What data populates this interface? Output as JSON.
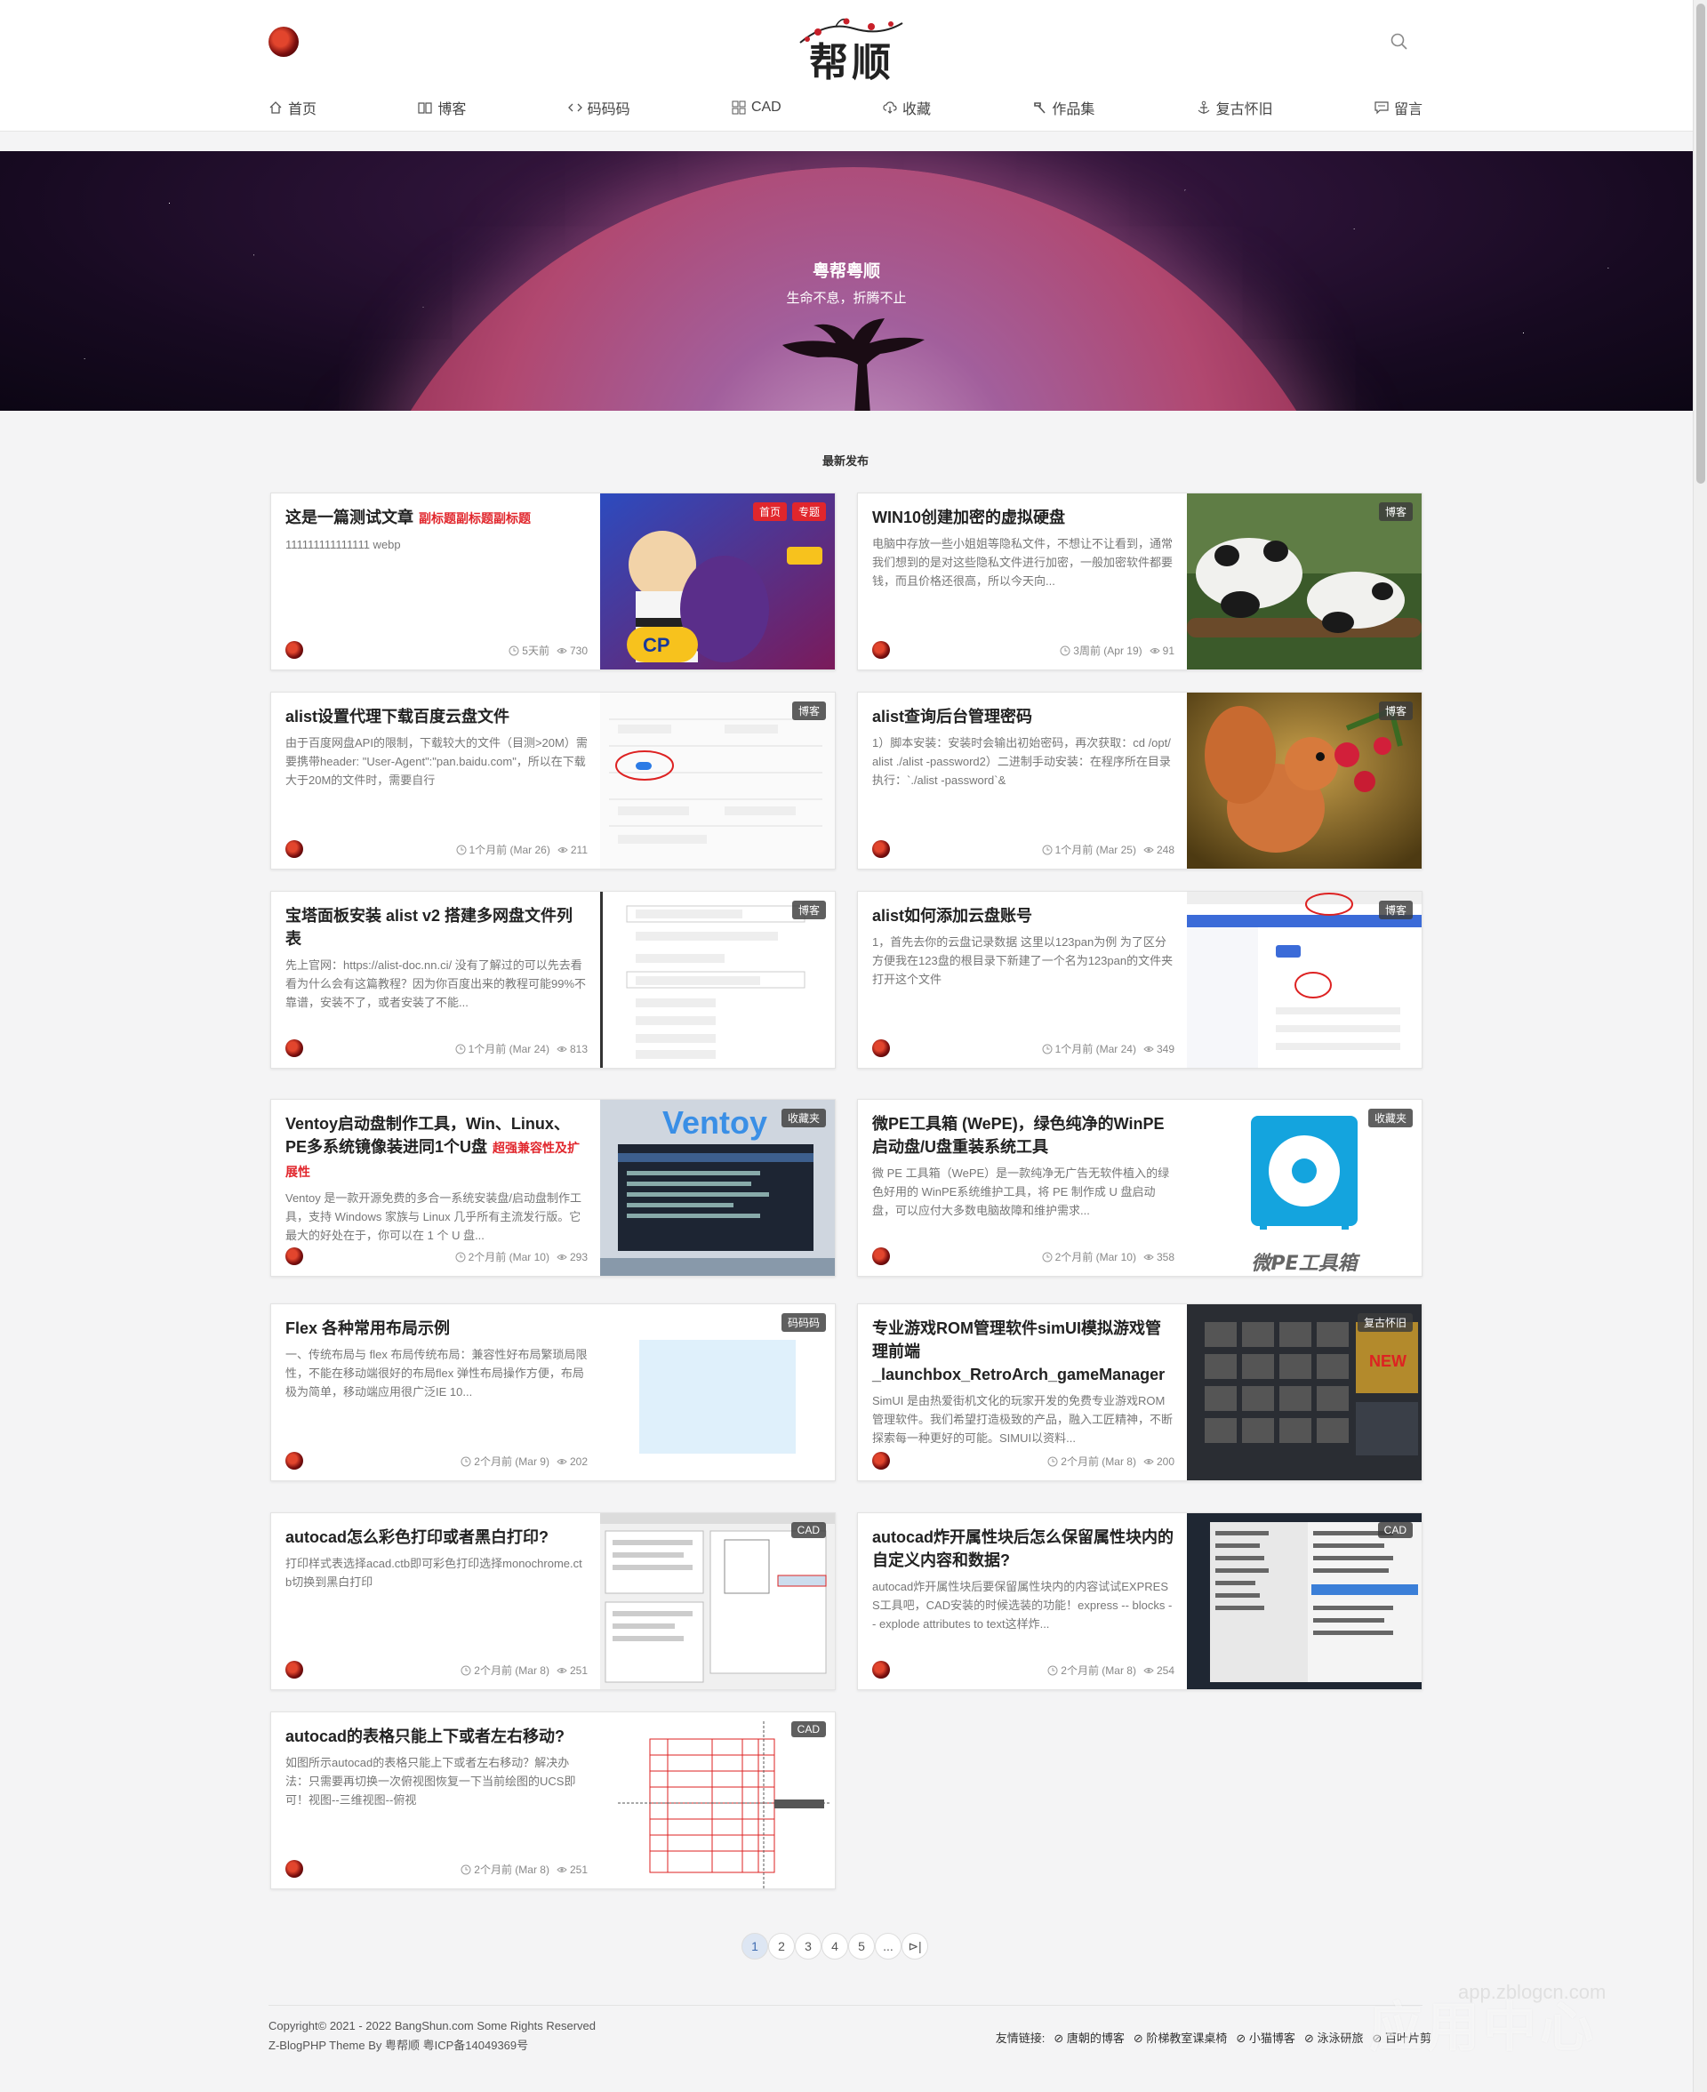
{
  "header": {
    "logo_text": "帮顺",
    "nav": [
      {
        "label": "首页",
        "icon": "home-icon"
      },
      {
        "label": "博客",
        "icon": "book-icon"
      },
      {
        "label": "码码码",
        "icon": "code-icon"
      },
      {
        "label": "CAD",
        "icon": "grid-icon"
      },
      {
        "label": "收藏",
        "icon": "cloud-download-icon"
      },
      {
        "label": "作品集",
        "icon": "hammer-icon"
      },
      {
        "label": "复古怀旧",
        "icon": "anchor-icon"
      },
      {
        "label": "留言",
        "icon": "message-icon"
      }
    ]
  },
  "banner": {
    "title": "粤帮粤顺",
    "subtitle": "生命不息，折腾不止"
  },
  "section_title": "最新发布",
  "posts": [
    {
      "title": "这是一篇测试文章",
      "subtitle": "副标题副标题副标题",
      "excerpt": "111111111111111 webp",
      "time": "5天前",
      "views": "730",
      "tags": [
        {
          "label": "首页",
          "style": "red"
        },
        {
          "label": "专题",
          "style": "red"
        }
      ],
      "thumb": "game-art"
    },
    {
      "title": "WIN10创建加密的虚拟硬盘",
      "subtitle": "",
      "excerpt": "电脑中存放一些小姐姐等隐私文件，不想让不让看到，通常我们想到的是对这些隐私文件进行加密，一般加密软件都要钱，而且价格还很高，所以今天向...",
      "time": "3周前 (Apr 19)",
      "views": "91",
      "tags": [
        {
          "label": "博客",
          "style": "dark"
        }
      ],
      "thumb": "panda"
    },
    {
      "title": "alist设置代理下载百度云盘文件",
      "subtitle": "",
      "excerpt": "由于百度网盘API的限制，下载较大的文件（目测>20M）需要携带header: \"User-Agent\":\"pan.baidu.com\"，所以在下载大于20M的文件时，需要自行",
      "time": "1个月前 (Mar 26)",
      "views": "211",
      "tags": [
        {
          "label": "博客",
          "style": "dark"
        }
      ],
      "thumb": "form-screenshot"
    },
    {
      "title": "alist查询后台管理密码",
      "subtitle": "",
      "excerpt": "1）脚本安装：安装时会输出初始密码，再次获取：cd /opt/alist ./alist -password2）二进制手动安装：在程序所在目录执行：`./alist -password`&",
      "time": "1个月前 (Mar 25)",
      "views": "248",
      "tags": [
        {
          "label": "博客",
          "style": "dark"
        }
      ],
      "thumb": "squirrel"
    },
    {
      "title": "宝塔面板安装 alist v2 搭建多网盘文件列表",
      "subtitle": "",
      "excerpt": "先上官网：https://alist-doc.nn.ci/ 没有了解过的可以先去看看为什么会有这篇教程？因为你百度出来的教程可能99%不靠谱，安装不了，或者安装了不能...",
      "time": "1个月前 (Mar 24)",
      "views": "813",
      "tags": [
        {
          "label": "博客",
          "style": "dark"
        }
      ],
      "thumb": "panel-screenshot"
    },
    {
      "title": "alist如何添加云盘账号",
      "subtitle": "",
      "excerpt": "1，首先去你的云盘记录数据 这里以123pan为例 为了区分方便我在123盘的根目录下新建了一个名为123pan的文件夹 打开这个文件",
      "time": "1个月前 (Mar 24)",
      "views": "349",
      "tags": [
        {
          "label": "博客",
          "style": "dark"
        }
      ],
      "thumb": "cloud-screenshot"
    },
    {
      "title": "Ventoy启动盘制作工具，Win、Linux、PE多系统镜像装进同1个U盘",
      "subtitle": "超强兼容性及扩展性",
      "excerpt": "Ventoy 是一款开源免费的多合一系统安装盘/启动盘制作工具，支持 Windows 家族与 Linux 几乎所有主流发行版。它最大的好处在于，你可以在 1 个 U 盘...",
      "time": "2个月前 (Mar 10)",
      "views": "293",
      "tags": [
        {
          "label": "收藏夹",
          "style": "dark"
        }
      ],
      "thumb": "ventoy"
    },
    {
      "title": "微PE工具箱 (WePE)，绿色纯净的WinPE启动盘/U盘重装系统工具",
      "subtitle": "",
      "excerpt": "微 PE 工具箱（WePE）是一款纯净无广告无软件植入的绿色好用的 WinPE系统维护工具，将 PE 制作成 U 盘启动盘，可以应付大多数电脑故障和维护需求...",
      "time": "2个月前 (Mar 10)",
      "views": "358",
      "tags": [
        {
          "label": "收藏夹",
          "style": "dark"
        }
      ],
      "thumb": "wepe",
      "thumb_caption": "微PE工具箱"
    },
    {
      "title": "Flex 各种常用布局示例",
      "subtitle": "",
      "excerpt": "一、传统布局与 flex 布局传统布局：兼容性好布局繁琐局限性，不能在移动端很好的布局flex 弹性布局操作方便，布局极为简单，移动端应用很广泛IE 10...",
      "time": "2个月前 (Mar 9)",
      "views": "202",
      "tags": [
        {
          "label": "码码码",
          "style": "dark"
        }
      ],
      "thumb": "flex-box"
    },
    {
      "title": "专业游戏ROM管理软件simUI模拟游戏管理前端_launchbox_RetroArch_gameManager",
      "subtitle": "",
      "excerpt": "SimUI 是由热爱街机文化的玩家开发的免费专业游戏ROM管理软件。我们希望打造极致的产品，融入工匠精神，不断探索每一种更好的可能。SIMUI以资料...",
      "time": "2个月前 (Mar 8)",
      "views": "200",
      "tags": [
        {
          "label": "复古怀旧",
          "style": "dark"
        }
      ],
      "thumb": "simui"
    },
    {
      "title": "autocad怎么彩色打印或者黑白打印?",
      "subtitle": "",
      "excerpt": "打印样式表选择acad.ctb即可彩色打印选择monochrome.ctb切换到黑白打印",
      "time": "2个月前 (Mar 8)",
      "views": "251",
      "tags": [
        {
          "label": "CAD",
          "style": "dark"
        }
      ],
      "thumb": "cad-print"
    },
    {
      "title": "autocad炸开属性块后怎么保留属性块内的自定义内容和数据?",
      "subtitle": "",
      "excerpt": "autocad炸开属性块后要保留属性块内的内容试试EXPRESS工具吧，CAD安装的时候选装的功能！express -- blocks -- explode attributes to text这样炸...",
      "time": "2个月前 (Mar 8)",
      "views": "254",
      "tags": [
        {
          "label": "CAD",
          "style": "dark"
        }
      ],
      "thumb": "cad-menu"
    },
    {
      "title": "autocad的表格只能上下或者左右移动?",
      "subtitle": "",
      "excerpt": "如图所示autocad的表格只能上下或者左右移动？解决办法：只需要再切换一次俯视图恢复一下当前绘图的UCS即可！视图--三维视图--俯视",
      "time": "2个月前 (Mar 8)",
      "views": "251",
      "tags": [
        {
          "label": "CAD",
          "style": "dark"
        }
      ],
      "thumb": "cad-table"
    }
  ],
  "pagination": {
    "pages": [
      "1",
      "2",
      "3",
      "4",
      "5",
      "...",
      "⊳|"
    ],
    "current": "1"
  },
  "footer": {
    "copyright_line1": "Copyright© 2021 - 2022 BangShun.com Some Rights Reserved",
    "copyright_line2": "Z-BlogPHP Theme By 粤帮顺  粤ICP备14049369号",
    "friend_label": "友情链接:",
    "friend_links": [
      "唐朝的博客",
      "阶梯教室课桌椅",
      "小猫博客",
      "泳泳研旅",
      "百叶片剪"
    ]
  },
  "watermark": {
    "text": "应用中心",
    "url": "app.zblogcn.com"
  },
  "colors": {
    "accent_red": "#e1262c",
    "tag_bg": "#3c3c3c",
    "page_active": "#dde6f3"
  }
}
